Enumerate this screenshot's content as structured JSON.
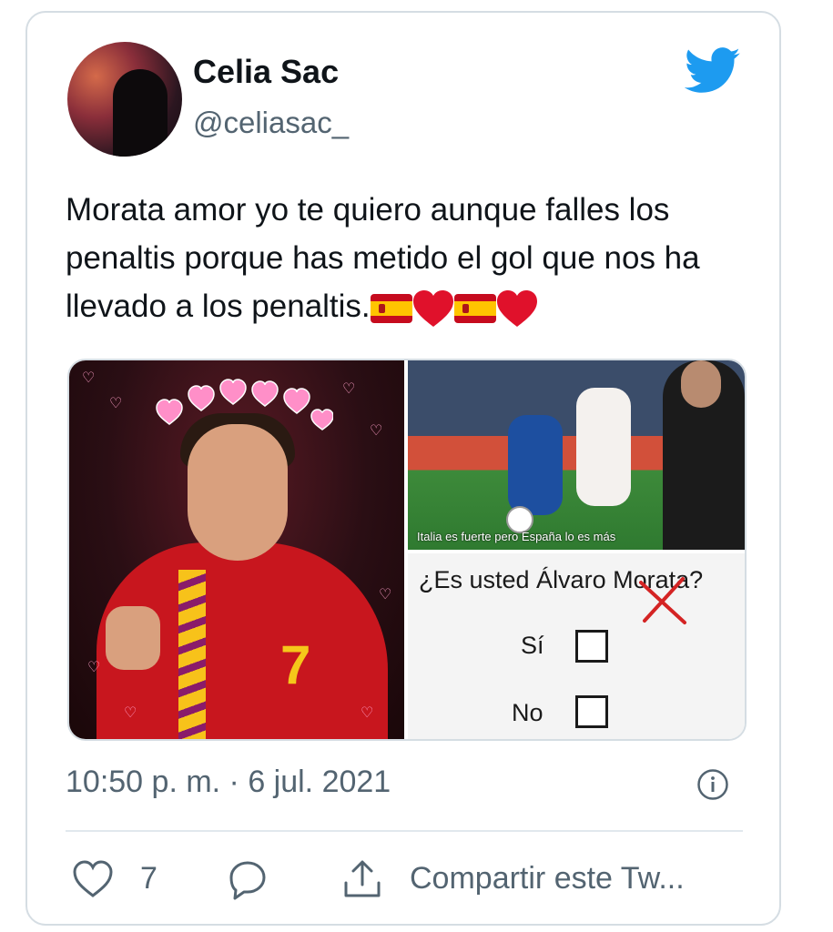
{
  "author": {
    "display_name": "Celia Sac",
    "handle": "@celiasac_"
  },
  "tweet": {
    "text": "Morata amor yo te quiero aunque falles los penaltis porque has metido el gol que nos ha llevado a los penaltis.",
    "emojis": [
      "flag-spain",
      "red-heart",
      "flag-spain",
      "red-heart"
    ]
  },
  "media": {
    "image2_caption": "Italia es fuerte pero España lo es más",
    "image3": {
      "question": "¿Es usted Álvaro Morata?",
      "option_yes": "Sí",
      "option_no": "No"
    },
    "image1_number": "7"
  },
  "meta": {
    "timestamp": "10:50 p. m. · 6 jul. 2021"
  },
  "actions": {
    "like_count": "7",
    "share_label": "Compartir este Tw..."
  },
  "colors": {
    "twitter_blue": "#1d9bf0",
    "text_primary": "#0f1419",
    "text_secondary": "#536471",
    "border": "#d5dde3"
  },
  "icons": [
    "twitter-bird-icon",
    "info-icon",
    "heart-icon",
    "reply-icon",
    "share-icon"
  ]
}
